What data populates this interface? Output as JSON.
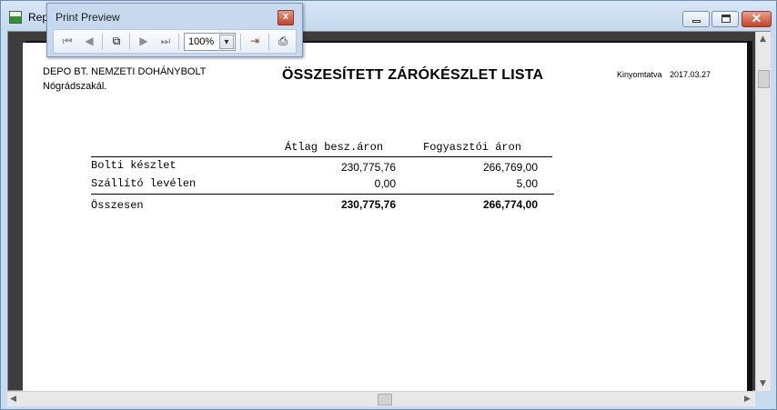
{
  "window": {
    "title": "Rep"
  },
  "print_preview": {
    "title": "Print Preview",
    "zoom": "100%",
    "close_label": "x",
    "tools": {
      "first_page": "first-page-icon",
      "prev_page": "previous-page-icon",
      "copy": "copy-page-icon",
      "next_page": "next-page-icon",
      "last_page": "last-page-icon",
      "exit": "exit-door-icon",
      "print": "printer-icon"
    }
  },
  "report": {
    "company": "DEPO BT. NEMZETI DOHÁNYBOLT",
    "location": "Nógrádszakál.",
    "title": "ÖSSZESÍTETT ZÁRÓKÉSZLET LISTA",
    "printed_label": "Kinyomtatva",
    "printed_date": "2017.03.27",
    "columns": [
      "Átlag besz.áron",
      "Fogyasztói áron"
    ],
    "rows": [
      {
        "label": "Bolti készlet",
        "avg": "230,775,76",
        "consumer": "266,769,00"
      },
      {
        "label": "Szállító levélen",
        "avg": "0,00",
        "consumer": "5,00"
      }
    ],
    "total": {
      "label": "Összesen",
      "avg": "230,775,76",
      "consumer": "266,774,00"
    }
  }
}
